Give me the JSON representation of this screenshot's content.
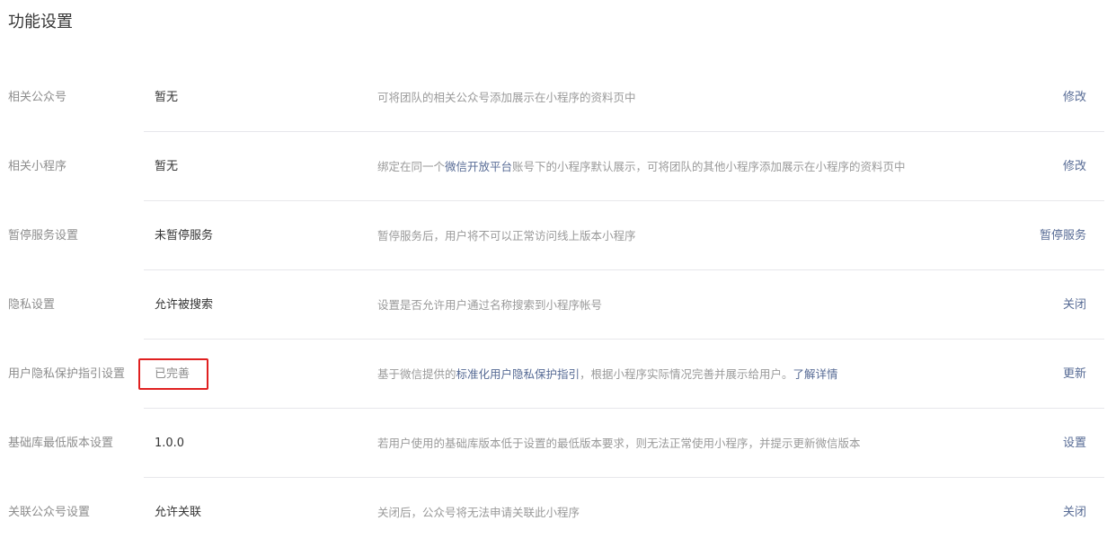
{
  "page": {
    "title": "功能设置"
  },
  "rows": [
    {
      "label": "相关公众号",
      "value": "暂无",
      "desc": {
        "before": "可将团队的相关公众号添加展示在小程序的资料页中",
        "link": "",
        "middle": "",
        "link2": "",
        "after": ""
      },
      "action": "修改"
    },
    {
      "label": "相关小程序",
      "value": "暂无",
      "desc": {
        "before": "绑定在同一个",
        "link": "微信开放平台",
        "middle": "账号下的小程序默认展示，可将团队的其他小程序添加展示在小程序的资料页中",
        "link2": "",
        "after": ""
      },
      "action": "修改"
    },
    {
      "label": "暂停服务设置",
      "value": "未暂停服务",
      "desc": {
        "before": "暂停服务后，用户将不可以正常访问线上版本小程序",
        "link": "",
        "middle": "",
        "link2": "",
        "after": ""
      },
      "action": "暂停服务"
    },
    {
      "label": "隐私设置",
      "value": "允许被搜索",
      "desc": {
        "before": "设置是否允许用户通过名称搜索到小程序帐号",
        "link": "",
        "middle": "",
        "link2": "",
        "after": ""
      },
      "action": "关闭"
    },
    {
      "label": "用户隐私保护指引设置",
      "value": "已完善",
      "desc": {
        "before": "基于微信提供的",
        "link": "标准化用户隐私保护指引",
        "middle": "，根据小程序实际情况完善并展示给用户。",
        "link2": "了解详情",
        "after": ""
      },
      "action": "更新"
    },
    {
      "label": "基础库最低版本设置",
      "value": "1.0.0",
      "desc": {
        "before": "若用户使用的基础库版本低于设置的最低版本要求，则无法正常使用小程序，并提示更新微信版本",
        "link": "",
        "middle": "",
        "link2": "",
        "after": ""
      },
      "action": "设置"
    },
    {
      "label": "关联公众号设置",
      "value": "允许关联",
      "desc": {
        "before": "关闭后，公众号将无法申请关联此小程序",
        "link": "",
        "middle": "",
        "link2": "",
        "after": ""
      },
      "action": "关闭"
    }
  ],
  "colors": {
    "link": "#576b95",
    "highlight": "#e02020",
    "label": "#8d8d8d",
    "separator": "#e7e7eb"
  }
}
